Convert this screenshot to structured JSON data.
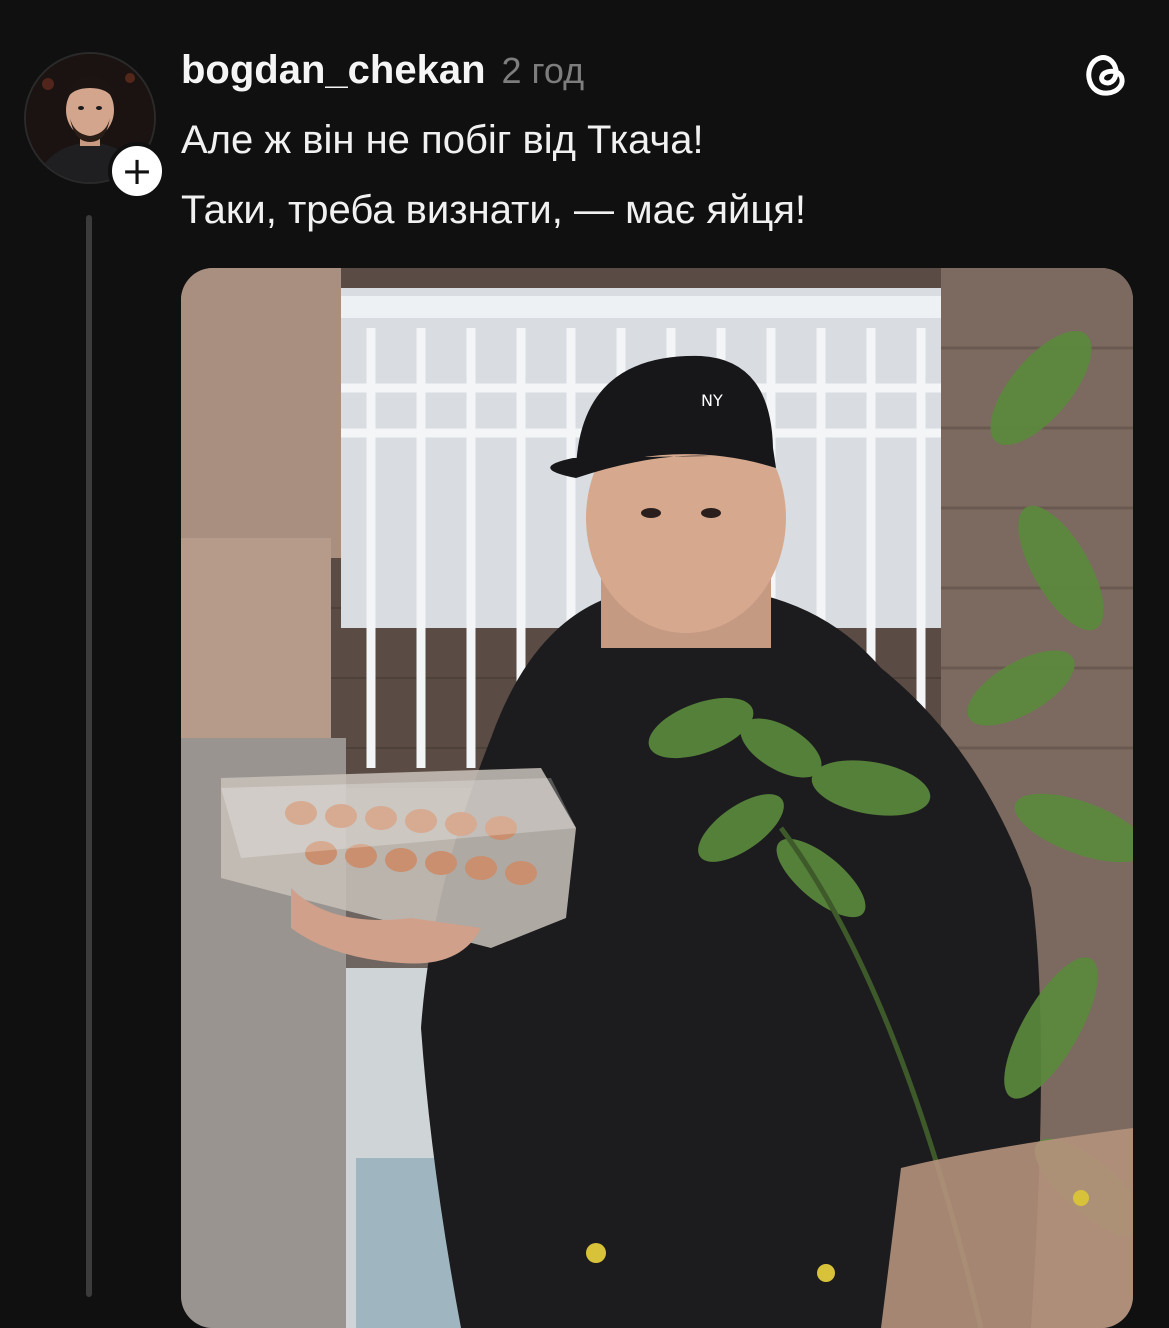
{
  "post": {
    "username": "bogdan_chekan",
    "time": "2 год",
    "lines": [
      "Але ж він не побіг від Ткача!",
      "Таки, треба визнати, — має яйця!"
    ],
    "follow_symbol": "+",
    "cap_logo": "NY"
  },
  "icons": {
    "follow": "plus-icon",
    "app": "threads-logo-icon"
  }
}
